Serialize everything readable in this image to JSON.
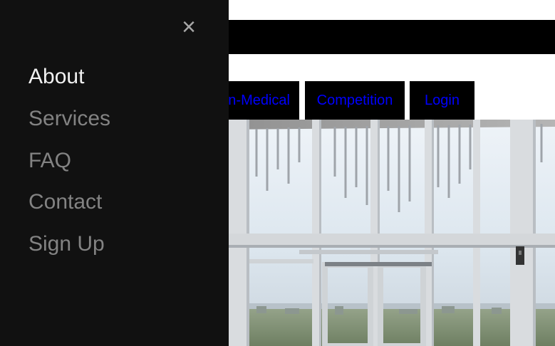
{
  "header": {
    "bar_color": "#000000"
  },
  "tabs": [
    {
      "label": "Non-Medical"
    },
    {
      "label": "Competition"
    },
    {
      "label": "Login"
    }
  ],
  "hero": {
    "icon": "window-interior-photo"
  },
  "sidenav": {
    "close_label": "×",
    "items": [
      {
        "label": "About",
        "active": true
      },
      {
        "label": "Services"
      },
      {
        "label": "FAQ"
      },
      {
        "label": "Contact"
      },
      {
        "label": "Sign Up"
      }
    ],
    "background": "#111111",
    "link_color": "#838383",
    "active_color": "#f1f1f1"
  },
  "colors": {
    "tab_text": "#0000ff",
    "tab_bg": "#000000"
  }
}
